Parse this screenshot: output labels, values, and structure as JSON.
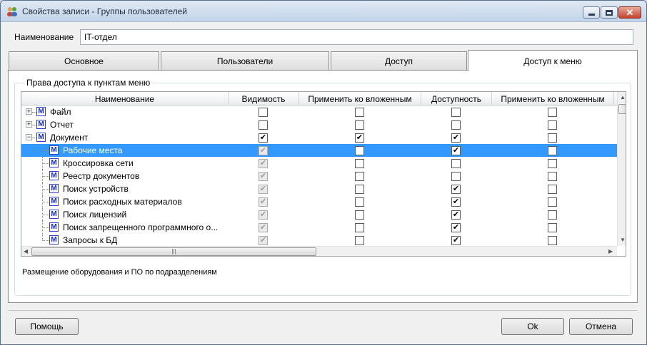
{
  "window": {
    "title": "Свойства записи - Группы пользователей"
  },
  "name_field": {
    "label": "Наименование",
    "value": "IT-отдел"
  },
  "tabs": [
    {
      "label": "Основное",
      "active": false
    },
    {
      "label": "Пользователи",
      "active": false
    },
    {
      "label": "Доступ",
      "active": false
    },
    {
      "label": "Доступ к меню",
      "active": true
    }
  ],
  "group_title": "Права доступа к пунктам меню",
  "grid": {
    "columns": [
      "Наименование",
      "Видимость",
      "Применить ко вложенным",
      "Доступность",
      "Применить ко вложенным"
    ],
    "rows": [
      {
        "label": "Файл",
        "level": 0,
        "expander": "+",
        "checks": [
          false,
          false,
          false,
          false
        ],
        "disabled_first": false,
        "selected": false
      },
      {
        "label": "Отчет",
        "level": 0,
        "expander": "+",
        "checks": [
          false,
          false,
          false,
          false
        ],
        "disabled_first": false,
        "selected": false
      },
      {
        "label": "Документ",
        "level": 0,
        "expander": "−",
        "checks": [
          true,
          true,
          true,
          false
        ],
        "disabled_first": false,
        "selected": false
      },
      {
        "label": "Рабочие места",
        "level": 1,
        "expander": "",
        "checks": [
          true,
          false,
          true,
          false
        ],
        "disabled_first": true,
        "selected": true
      },
      {
        "label": "Кроссировка сети",
        "level": 1,
        "expander": "",
        "checks": [
          true,
          false,
          false,
          false
        ],
        "disabled_first": true,
        "selected": false
      },
      {
        "label": "Реестр документов",
        "level": 1,
        "expander": "",
        "checks": [
          true,
          false,
          false,
          false
        ],
        "disabled_first": true,
        "selected": false
      },
      {
        "label": "Поиск устройств",
        "level": 1,
        "expander": "",
        "checks": [
          true,
          false,
          true,
          false
        ],
        "disabled_first": true,
        "selected": false
      },
      {
        "label": "Поиск расходных материалов",
        "level": 1,
        "expander": "",
        "checks": [
          true,
          false,
          true,
          false
        ],
        "disabled_first": true,
        "selected": false
      },
      {
        "label": "Поиск лицензий",
        "level": 1,
        "expander": "",
        "checks": [
          true,
          false,
          true,
          false
        ],
        "disabled_first": true,
        "selected": false
      },
      {
        "label": "Поиск запрещенного программного о...",
        "level": 1,
        "expander": "",
        "checks": [
          true,
          false,
          true,
          false
        ],
        "disabled_first": true,
        "selected": false
      },
      {
        "label": "Запросы к БД",
        "level": 1,
        "expander": "",
        "checks": [
          true,
          false,
          true,
          false
        ],
        "disabled_first": true,
        "selected": false
      }
    ]
  },
  "description": "Размещение оборудования и ПО по подразделениям",
  "buttons": {
    "help": "Помощь",
    "ok": "Ok",
    "cancel": "Отмена"
  },
  "icons": {
    "app": "users-icon",
    "menu_item": "menu-m-icon",
    "check": "✔"
  },
  "colors": {
    "selection": "#3399ff",
    "menu_icon": "#1a2cc4",
    "close_button": "#c7402a"
  }
}
